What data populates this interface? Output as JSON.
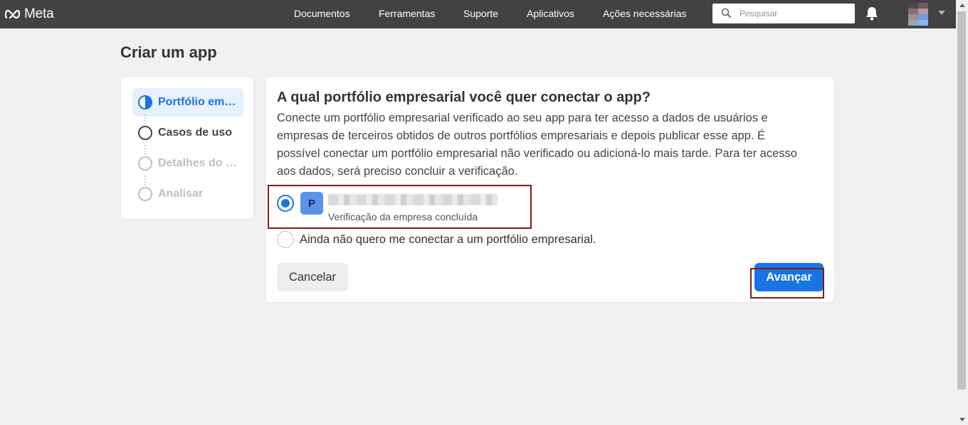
{
  "topnav": {
    "brand": "Meta",
    "links": [
      "Documentos",
      "Ferramentas",
      "Suporte",
      "Aplicativos",
      "Ações necessárias"
    ],
    "search_placeholder": "Pesquisar",
    "icons": {
      "search": "search-icon",
      "notifications": "bell-icon",
      "profile_menu": "chevron-down-icon"
    }
  },
  "page": {
    "title": "Criar um app"
  },
  "steps": [
    {
      "label": "Portfólio em…",
      "state": "active"
    },
    {
      "label": "Casos de uso",
      "state": "pending"
    },
    {
      "label": "Detalhes do …",
      "state": "disabled"
    },
    {
      "label": "Analisar",
      "state": "disabled"
    }
  ],
  "main": {
    "question": "A qual portfólio empresarial você quer conectar o app?",
    "description": "Conecte um portfólio empresarial verificado ao seu app para ter acesso a dados de usuários e empresas de terceiros obtidos de outros portfólios empresariais e depois publicar esse app. É possível conectar um portfólio empresarial não verificado ou adicioná-lo mais tarde. Para ter acesso aos dados, será preciso concluir a verificação.",
    "options": [
      {
        "icon_letter": "P",
        "status": "Verificação da empresa concluída",
        "selected": true
      },
      {
        "label": "Ainda não quero me conectar a um portfólio empresarial.",
        "selected": false
      }
    ],
    "cancel_label": "Cancelar",
    "next_label": "Avançar"
  },
  "colors": {
    "nav_bg": "#424242",
    "accent": "#1b74e4",
    "highlight_box": "#7b1c1c",
    "page_bg": "#f0f0f0"
  }
}
